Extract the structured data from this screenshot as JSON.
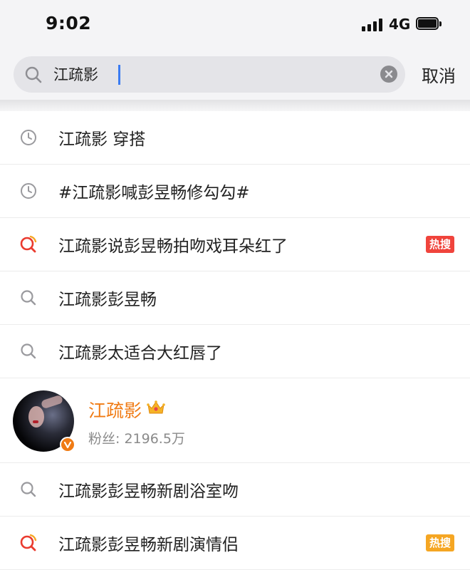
{
  "status_bar": {
    "time": "9:02",
    "network": "4G"
  },
  "search": {
    "value": "江疏影",
    "cancel_label": "取消"
  },
  "suggestions_top": [
    {
      "text": "江疏影 穿搭",
      "icon": "history-clock-icon"
    },
    {
      "text": "#江疏影喊彭昱畅修勾勾#",
      "icon": "history-clock-icon"
    },
    {
      "text": "江疏影说彭昱畅拍吻戏耳朵红了",
      "icon": "hot-search-icon",
      "badge": "热搜",
      "badge_color": "#f0443c"
    },
    {
      "text": "江疏影彭昱畅",
      "icon": "search-icon"
    },
    {
      "text": "江疏影太适合大红唇了",
      "icon": "search-icon"
    }
  ],
  "user_card": {
    "name": "江疏影",
    "followers": "粉丝: 2196.5万",
    "name_color": "#f07b14"
  },
  "suggestions_bottom": [
    {
      "text": "江疏影彭昱畅新剧浴室吻",
      "icon": "search-icon"
    },
    {
      "text": "江疏影彭昱畅新剧演情侣",
      "icon": "hot-search-icon",
      "badge": "热搜",
      "badge_color": "#f5a623"
    }
  ]
}
